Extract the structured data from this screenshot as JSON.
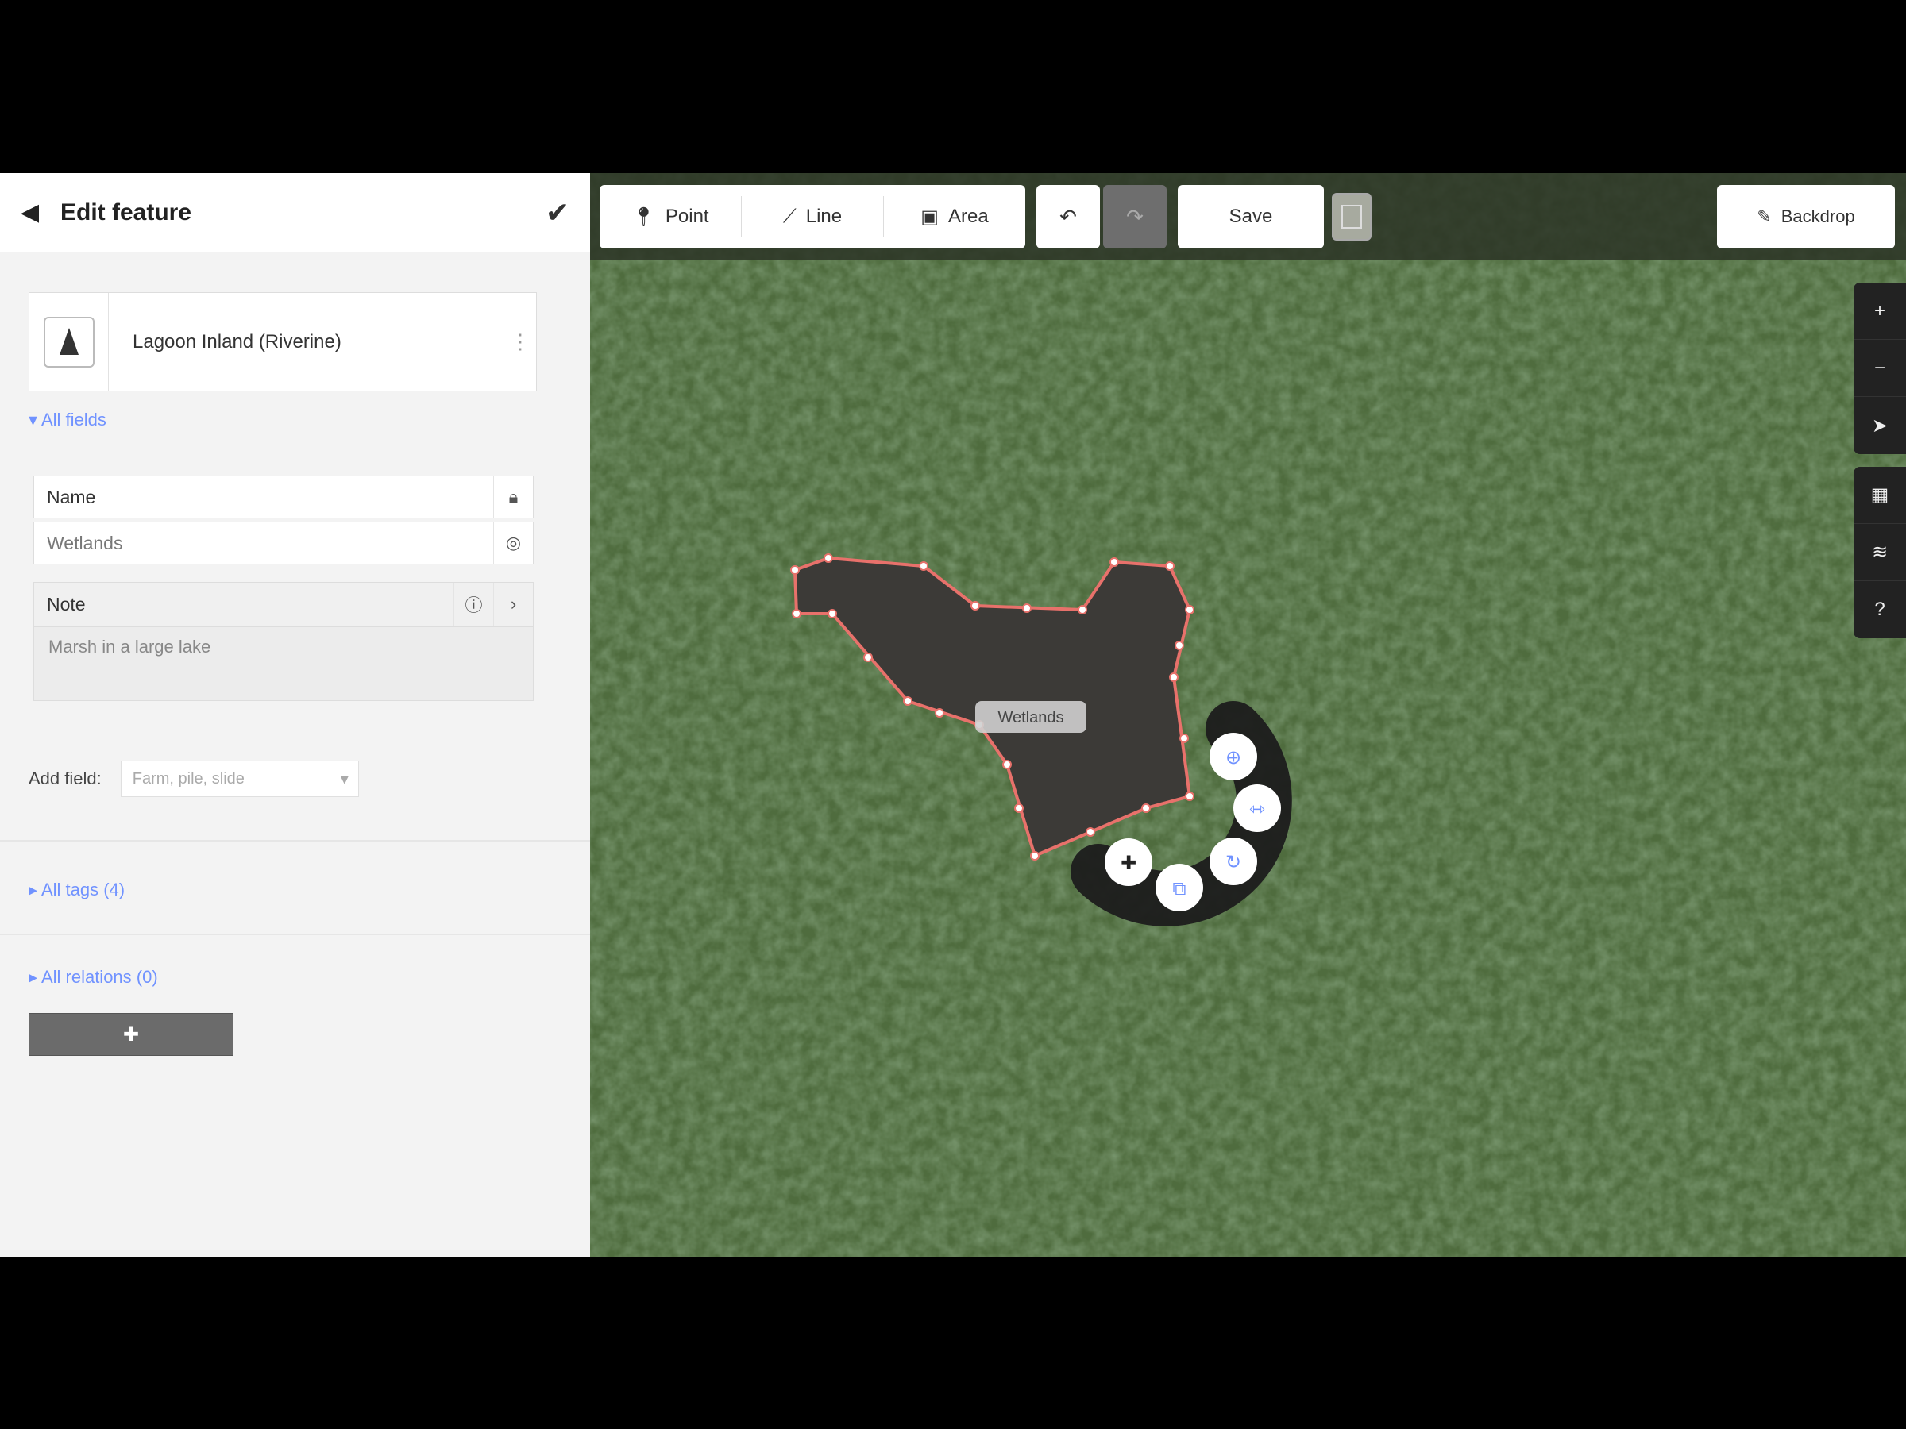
{
  "sidebar": {
    "back_icon": "back-arrow-icon",
    "title": "Edit feature",
    "confirm_icon": "check-icon",
    "preset": {
      "icon": "water-icon",
      "label": "Lagoon Inland (Riverine)",
      "more": "⋮"
    },
    "fields_link": "▾ All fields",
    "fields": {
      "name_label": "Name",
      "name_lock_icon": "lock-icon",
      "name_value_label": "Wetlands",
      "name_value_icon": "globe-icon",
      "note_label": "Note",
      "note_icon_1": "info-icon",
      "note_icon_2": "chevron-right-icon",
      "note_text": "Marsh in a large lake"
    },
    "tag_label": "Add field:",
    "tag_placeholder": "Farm, pile, slide",
    "tags_link": "▸ All tags (4)",
    "relations_link": "▸ All relations (0)",
    "add_button_icon": "plus-icon"
  },
  "toolbar": {
    "point_label": "Point",
    "line_label": "Line",
    "area_label": "Area",
    "undo_icon": "undo-icon",
    "redo_icon": "redo-icon",
    "save_label": "Save",
    "background_icon": "layers-icon",
    "measure_label": "Backdrop",
    "measure_icon": "edit-icon"
  },
  "map": {
    "feature_label": "Wetlands",
    "controls": [
      "zoom-in-icon",
      "zoom-out-icon",
      "locate-icon",
      "background-icon",
      "map-data-icon",
      "help-icon"
    ],
    "colors": {
      "polygon_fill": "#3c3a37",
      "polygon_stroke": "#e8716b",
      "vegetation": "#4d6b3d"
    }
  }
}
